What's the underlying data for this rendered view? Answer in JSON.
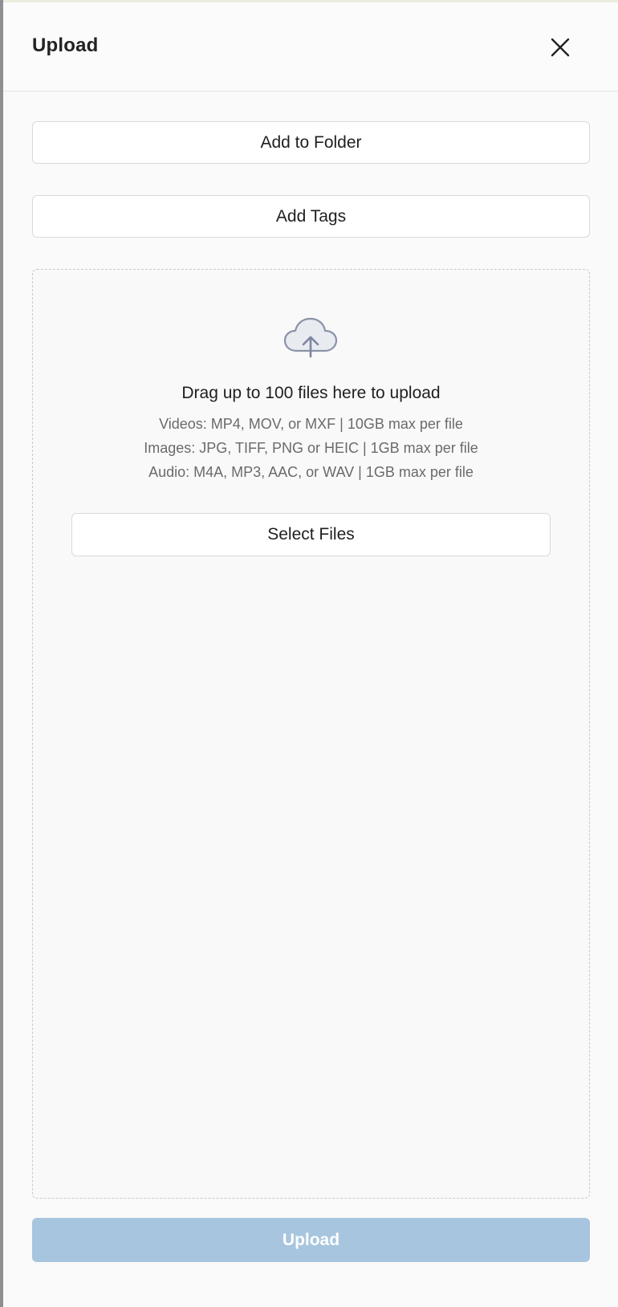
{
  "header": {
    "title": "Upload",
    "close_icon": "close-icon"
  },
  "actions": {
    "add_folder_label": "Add to Folder",
    "add_tags_label": "Add Tags"
  },
  "dropzone": {
    "icon": "cloud-upload-icon",
    "headline": "Drag up to 100 files here to upload",
    "videos": "Videos: MP4, MOV, or MXF | 10GB max per file",
    "images": "Images: JPG, TIFF, PNG or HEIC | 1GB max per file",
    "audio": "Audio: M4A, MP3, AAC, or WAV | 1GB max per file",
    "select_label": "Select Files"
  },
  "footer": {
    "upload_label": "Upload",
    "upload_disabled": true
  },
  "colors": {
    "upload_button_disabled": "#a7c5de",
    "icon_stroke": "#8b93a8",
    "icon_fill": "#e8ebf0"
  }
}
